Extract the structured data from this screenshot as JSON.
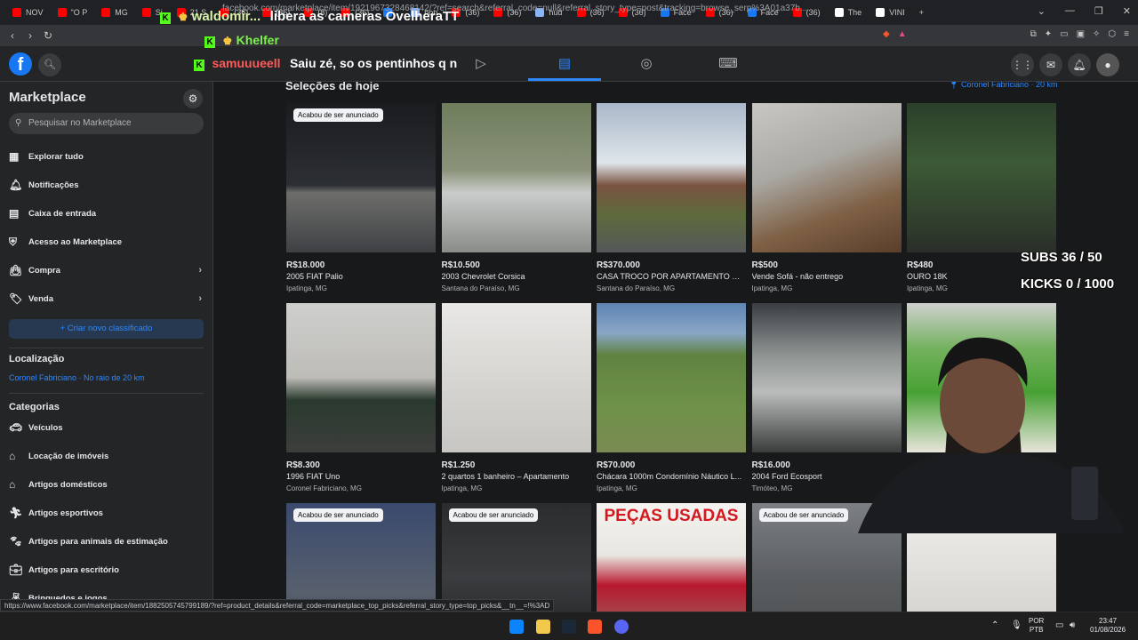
{
  "browser": {
    "tabs": [
      {
        "label": "NOV",
        "color": "#ff0000"
      },
      {
        "label": "\"O P",
        "color": "#ff0000"
      },
      {
        "label": "MG",
        "color": "#ff0000"
      },
      {
        "label": "Si",
        "color": "#ff0000"
      },
      {
        "label": "21 S",
        "color": "#ff0000"
      },
      {
        "label": "(36)",
        "color": "#ff0000"
      },
      {
        "label": "(36)",
        "color": "#ff0000"
      },
      {
        "label": "(8)",
        "color": "#ff0000"
      },
      {
        "label": "(36)",
        "color": "#ff0000"
      },
      {
        "label": "",
        "color": "#1877f2"
      },
      {
        "label": "hon",
        "color": "#8ab4f8"
      },
      {
        "label": "(36)",
        "color": "#ff0000"
      },
      {
        "label": "(36)",
        "color": "#ff0000"
      },
      {
        "label": "huα",
        "color": "#8ab4f8"
      },
      {
        "label": "(36)",
        "color": "#ff0000"
      },
      {
        "label": "(36)",
        "color": "#ff0000"
      },
      {
        "label": "Face",
        "color": "#1877f2"
      },
      {
        "label": "(36)",
        "color": "#ff0000"
      },
      {
        "label": "Face",
        "color": "#1877f2"
      },
      {
        "label": "(36)",
        "color": "#ff0000"
      },
      {
        "label": "The",
        "color": "#ffffff"
      },
      {
        "label": "VINI",
        "color": "#ffffff"
      }
    ],
    "new_tab": "+",
    "url": "facebook.com/marketplace/item/1921967328468142/?ref=search&referral_code=null&referral_story_type=post&tracking=browse_serp%3A01a37b...",
    "status_url": "https://www.facebook.com/marketplace/item/1882505745799189/?ref=product_details&referral_code=marketplace_top_picks&referral_story_type=top_picks&__tn__=!%3AD"
  },
  "sidebar": {
    "title": "Marketplace",
    "search_placeholder": "Pesquisar no Marketplace",
    "nav": [
      {
        "label": "Explorar tudo",
        "icon": "storefront-icon"
      },
      {
        "label": "Notificações",
        "icon": "bell-icon"
      },
      {
        "label": "Caixa de entrada",
        "icon": "inbox-icon"
      },
      {
        "label": "Acesso ao Marketplace",
        "icon": "shield-icon"
      },
      {
        "label": "Compra",
        "icon": "bag-icon"
      },
      {
        "label": "Venda",
        "icon": "tag-icon"
      }
    ],
    "create_label": "+ Criar novo classificado",
    "location_header": "Localização",
    "location_value": "Coronel Fabriciano · No raio de 20 km",
    "categories_header": "Categorias",
    "categories": [
      {
        "label": "Veículos",
        "icon": "car-icon"
      },
      {
        "label": "Locação de imóveis",
        "icon": "house-tag-icon"
      },
      {
        "label": "Artigos domésticos",
        "icon": "home-icon"
      },
      {
        "label": "Artigos esportivos",
        "icon": "run-icon"
      },
      {
        "label": "Artigos para animais de estimação",
        "icon": "paw-icon"
      },
      {
        "label": "Artigos para escritório",
        "icon": "briefcase-icon"
      },
      {
        "label": "Brinquedos e jogos",
        "icon": "toy-icon"
      }
    ]
  },
  "main": {
    "title": "Seleções de hoje",
    "location": "Coronel Fabriciano · 20 km",
    "badge_text": "Acabou de ser anunciado",
    "listings": [
      {
        "price": "R$18.000",
        "title": "2005 FIAT Palio",
        "city": "Ipatinga, MG",
        "badge": true
      },
      {
        "price": "R$10.500",
        "title": "2003 Chevrolet Corsica",
        "city": "Santana do Paraíso, MG",
        "badge": false
      },
      {
        "price": "R$370.000",
        "title": "CASA TROCO POR APARTAMENTO OU ...",
        "city": "Santana do Paraíso, MG",
        "badge": false
      },
      {
        "price": "R$500",
        "title": "Vende Sofá - não entrego",
        "city": "Ipatinga, MG",
        "badge": false
      },
      {
        "price": "R$480",
        "title": "OURO 18K",
        "city": "Ipatinga, MG",
        "badge": false
      },
      {
        "price": "R$8.300",
        "title": "1996 FIAT Uno",
        "city": "Coronel Fabriciano, MG",
        "badge": false
      },
      {
        "price": "R$1.250",
        "title": "2 quartos 1 banheiro – Apartamento",
        "city": "Ipatinga, MG",
        "badge": false
      },
      {
        "price": "R$70.000",
        "title": "Chácara 1000m Condomínio Náutico L...",
        "city": "Ipatinga, MG",
        "badge": false
      },
      {
        "price": "R$16.000",
        "title": "2004 Ford Ecosport",
        "city": "Timóteo, MG",
        "badge": false
      },
      {
        "price": "",
        "title": "",
        "city": "",
        "badge": false
      },
      {
        "price": "",
        "title": "",
        "city": "",
        "badge": true
      },
      {
        "price": "",
        "title": "",
        "city": "",
        "badge": true
      },
      {
        "price": "",
        "title": "",
        "city": "",
        "badge": false,
        "overlay": "PEÇAS USADAS"
      },
      {
        "price": "",
        "title": "",
        "city": "",
        "badge": true
      },
      {
        "price": "",
        "title": "",
        "city": "",
        "badge": false
      }
    ]
  },
  "stream_overlay": {
    "chat": [
      {
        "user": "waldomir...",
        "message": "libera as cameras OvelheraTT",
        "user_color": "#d9f2a8"
      },
      {
        "user": "Khelfer",
        "message": "",
        "user_color": "#7df04e"
      },
      {
        "user": "samuuueell",
        "message": "Saiu zé, so os pentinhos q n",
        "user_color": "#ff5a5a"
      }
    ],
    "subs": "SUBS 36 / 50",
    "kicks": "KICKS 0 / 1000"
  },
  "taskbar": {
    "lang_top": "POR",
    "lang_bottom": "PTB",
    "time": "23:47",
    "date": "01/08/2026"
  },
  "colors": {
    "accent": "#2d88ff",
    "fb_blue": "#1877f2",
    "bg": "#18191a",
    "panel": "#242526"
  }
}
